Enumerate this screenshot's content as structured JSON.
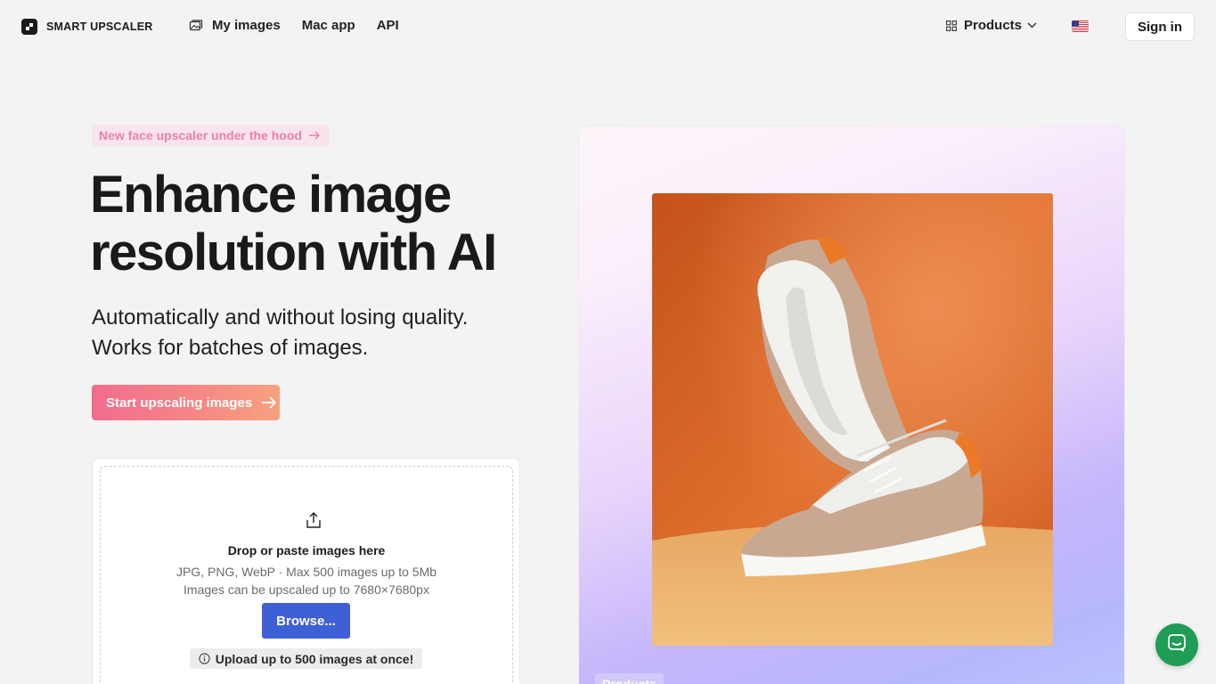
{
  "header": {
    "logo_text": "SMART UPSCALER",
    "nav": [
      {
        "label": "My images",
        "icon": "image-icon"
      },
      {
        "label": "Mac app"
      },
      {
        "label": "API"
      }
    ],
    "products_label": "Products",
    "signin_label": "Sign in"
  },
  "hero": {
    "pill_text": "New face upscaler under the hood",
    "title_line1": "Enhance image",
    "title_line2": "resolution with AI",
    "subtitle_line1": "Automatically and without losing quality.",
    "subtitle_line2": "Works for batches of images.",
    "cta_label": "Start upscaling images"
  },
  "upload": {
    "title": "Drop or paste images here",
    "formats": "JPG, PNG, WebP · Max 500 images up to 5Mb",
    "limit": "Images can be upscaled up to 7680×7680px",
    "browse_label": "Browse...",
    "note": "Upload up to 500 images at once!"
  },
  "showcase": {
    "tag": "Products"
  },
  "colors": {
    "accent_blue": "#3f5fd6",
    "cta_pink": "#f26b8f",
    "pill_text": "#ea7fae",
    "chat_green": "#1f9d55"
  }
}
